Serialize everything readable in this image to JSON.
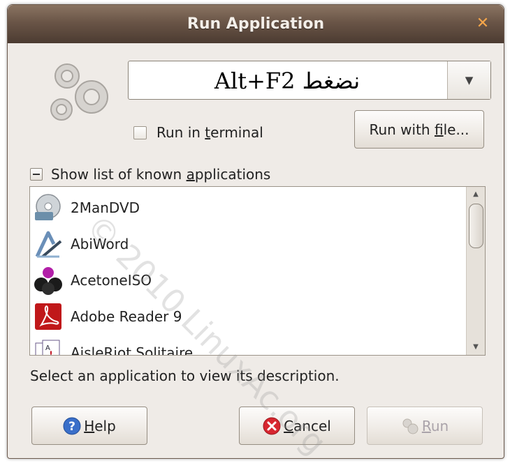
{
  "window": {
    "title": "Run Application"
  },
  "command": {
    "value": "Alt+F2 نضغط"
  },
  "checkbox": {
    "label_pre": "Run in ",
    "label_mnemonic": "t",
    "label_post": "erminal"
  },
  "run_with_file": {
    "label_pre": "Run with ",
    "label_mnemonic": "f",
    "label_post": "ile..."
  },
  "expander": {
    "label_pre": "Show list of known ",
    "label_mnemonic": "a",
    "label_post": "pplications"
  },
  "apps": [
    {
      "name": "2ManDVD",
      "icon": "dvd-disc-icon"
    },
    {
      "name": "AbiWord",
      "icon": "abiword-icon"
    },
    {
      "name": "AcetoneISO",
      "icon": "acetoneiso-icon"
    },
    {
      "name": "Adobe Reader 9",
      "icon": "adobe-reader-icon"
    },
    {
      "name": "AisleRiot Solitaire",
      "icon": "solitaire-cards-icon"
    }
  ],
  "status": {
    "text": "Select an application to view its description."
  },
  "buttons": {
    "help": {
      "mnemonic": "H",
      "rest": "elp"
    },
    "cancel": {
      "mnemonic": "C",
      "rest": "ancel"
    },
    "run": {
      "mnemonic": "R",
      "rest": "un"
    }
  },
  "watermark": {
    "text": "© 2010 LinuxAc.org"
  },
  "colors": {
    "titlebar": "#6a5547",
    "window_bg": "#efebe7",
    "close": "#f7a64a"
  }
}
